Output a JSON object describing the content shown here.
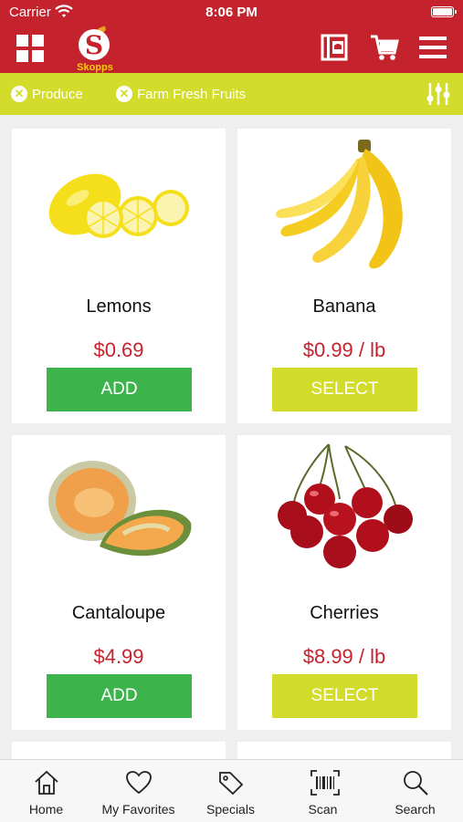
{
  "status_bar": {
    "carrier": "Carrier",
    "time": "8:06 PM"
  },
  "header": {
    "logo_text": "Skopps",
    "brand_color": "#c4232d",
    "accent_color": "#d3dc2a"
  },
  "filters": [
    {
      "label": "Produce"
    },
    {
      "label": "Farm Fresh Fruits"
    }
  ],
  "products": [
    {
      "name": "Lemons",
      "price": "$0.69",
      "button": "ADD"
    },
    {
      "name": "Banana",
      "price": "$0.99 / lb",
      "button": "SELECT"
    },
    {
      "name": "Cantaloupe",
      "price": "$4.99",
      "button": "ADD"
    },
    {
      "name": "Cherries",
      "price": "$8.99 / lb",
      "button": "SELECT"
    }
  ],
  "tabs": [
    {
      "label": "Home",
      "icon": "home-icon"
    },
    {
      "label": "My Favorites",
      "icon": "heart-icon"
    },
    {
      "label": "Specials",
      "icon": "tag-icon"
    },
    {
      "label": "Scan",
      "icon": "barcode-icon"
    },
    {
      "label": "Search",
      "icon": "search-icon"
    }
  ]
}
